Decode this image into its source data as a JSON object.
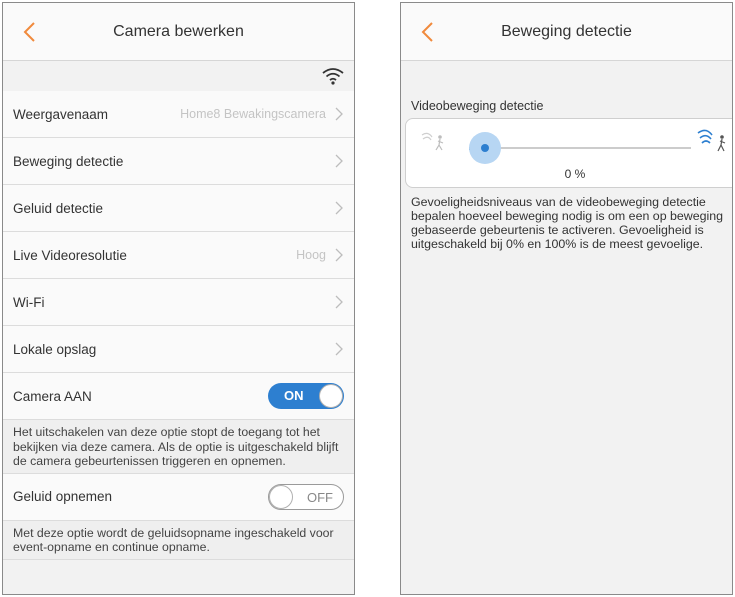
{
  "colors": {
    "accent_orange": "#f08a3c",
    "toggle_blue": "#2d7fd0",
    "value_gray": "#c4c4c4"
  },
  "left": {
    "title": "Camera bewerken",
    "rows": [
      {
        "label": "Weergavenaam",
        "value": "Home8 Bewakingscamera"
      },
      {
        "label": "Beweging detectie",
        "value": ""
      },
      {
        "label": "Geluid detectie",
        "value": ""
      },
      {
        "label": "Live Videoresolutie",
        "value": "Hoog"
      },
      {
        "label": "Wi-Fi",
        "value": ""
      },
      {
        "label": "Lokale opslag",
        "value": ""
      }
    ],
    "camera_toggle": {
      "label": "Camera AAN",
      "state": "ON"
    },
    "camera_note": "Het uitschakelen van deze optie stopt de toegang tot het bekijken via deze camera. Als de optie is uitgeschakeld blijft de camera gebeurtenissen triggeren en opnemen.",
    "audio_toggle": {
      "label": "Geluid opnemen",
      "state": "OFF"
    },
    "audio_note": "Met deze optie wordt de geluidsopname ingeschakeld voor event-opname en continue opname."
  },
  "right": {
    "title": "Beweging detectie",
    "section_label": "Videobeweging detectie",
    "slider": {
      "value": 0,
      "value_text": "0 %"
    },
    "description": "Gevoeligheidsniveaus van de videobeweging detectie bepalen hoeveel beweging nodig is om een op beweging gebaseerde gebeurtenis te activeren. Gevoeligheid is uitgeschakeld bij 0% en 100% is de meest gevoelige."
  }
}
